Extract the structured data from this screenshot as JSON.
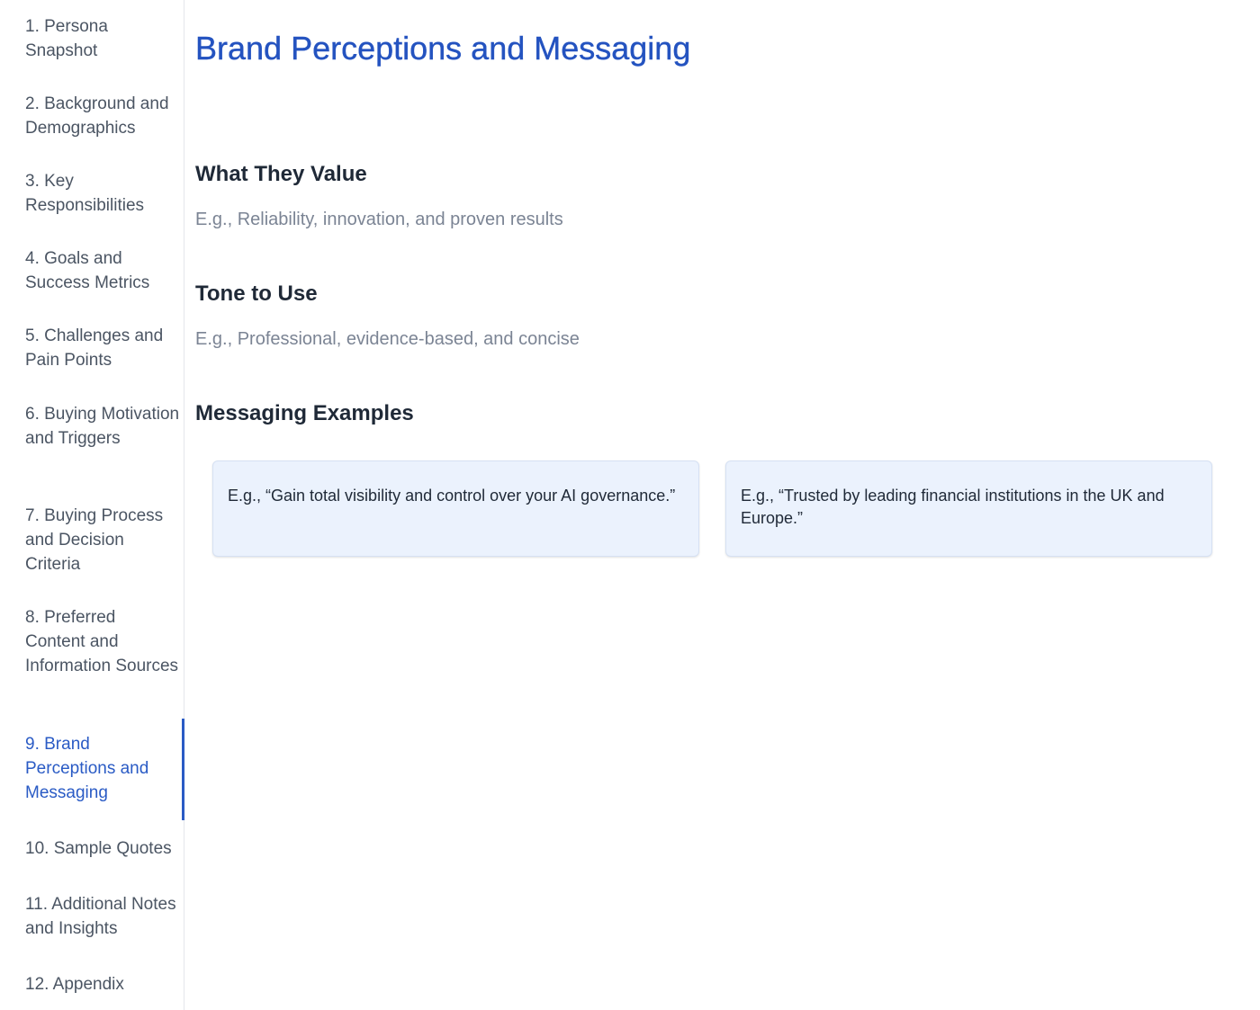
{
  "sidebar": {
    "items": [
      {
        "label": "1. Persona Snapshot"
      },
      {
        "label": "2. Background and Demographics"
      },
      {
        "label": "3. Key Responsibilities"
      },
      {
        "label": "4. Goals and Success Metrics"
      },
      {
        "label": "5. Challenges and Pain Points"
      },
      {
        "label": "6. Buying Motivation and Triggers"
      },
      {
        "label": "7. Buying Process and Decision Criteria"
      },
      {
        "label": "8. Preferred Content and Information Sources"
      },
      {
        "label": "9. Brand Perceptions and Messaging"
      },
      {
        "label": "10. Sample Quotes"
      },
      {
        "label": "11. Additional Notes and Insights"
      },
      {
        "label": "12. Appendix"
      }
    ],
    "active_index": 8
  },
  "main": {
    "title": "Brand Perceptions and Messaging",
    "sections": [
      {
        "heading": "What They Value",
        "text": "E.g., Reliability, innovation, and proven results"
      },
      {
        "heading": "Tone to Use",
        "text": "E.g., Professional, evidence-based, and concise"
      },
      {
        "heading": "Messaging Examples"
      }
    ],
    "examples": [
      {
        "text": "E.g., “Gain total visibility and control over your AI governance.”"
      },
      {
        "text": "E.g., “Trusted by leading financial institutions in the UK and Europe.”"
      }
    ]
  },
  "colors": {
    "accent": "#2453c0",
    "nav_text": "#4b5563",
    "muted_text": "#7b8494",
    "card_bg": "#ebf2fd"
  }
}
